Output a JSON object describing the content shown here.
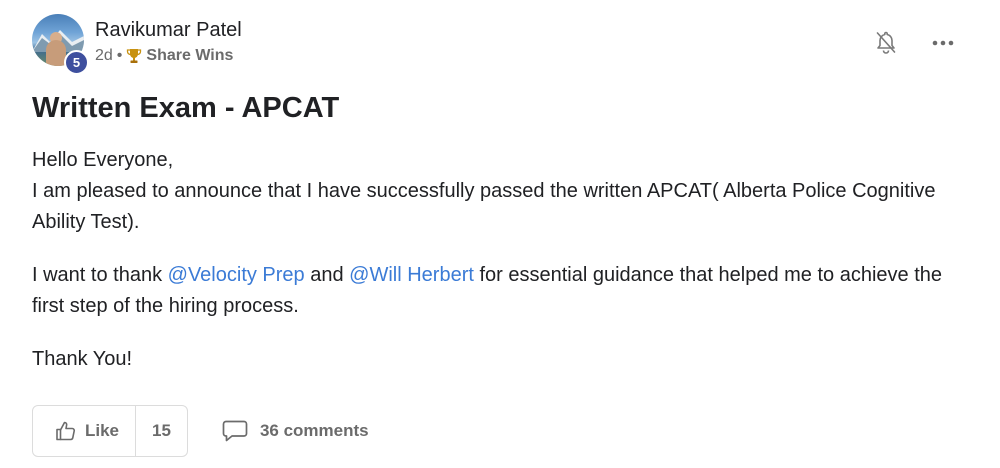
{
  "post": {
    "author": "Ravikumar Patel",
    "level": "5",
    "time": "2d",
    "separator": "•",
    "category": "Share Wins",
    "title": "Written Exam - APCAT",
    "body": {
      "greeting": "Hello Everyone,",
      "line1": "I am pleased to announce that I have successfully passed the written APCAT( Alberta Police Cognitive Ability Test).",
      "p2_prefix": "I want to thank ",
      "mention1": "@Velocity Prep",
      "p2_and": " and ",
      "mention2": "@Will Herbert",
      "p2_suffix": " for essential guidance that helped me to achieve the first step of the hiring process.",
      "closing": "Thank You!"
    }
  },
  "actions": {
    "like_label": "Like",
    "like_count": "15",
    "comments_label": "36 comments"
  },
  "icons": {
    "notification": "bell-off-icon",
    "more": "more-horizontal-icon",
    "trophy": "trophy-icon",
    "like": "thumbs-up-icon",
    "comments": "comment-bubble-icon"
  },
  "colors": {
    "mention": "#3b7bd6",
    "badge": "#3e4f9e",
    "muted": "#6b6b6b",
    "text": "#202124"
  }
}
